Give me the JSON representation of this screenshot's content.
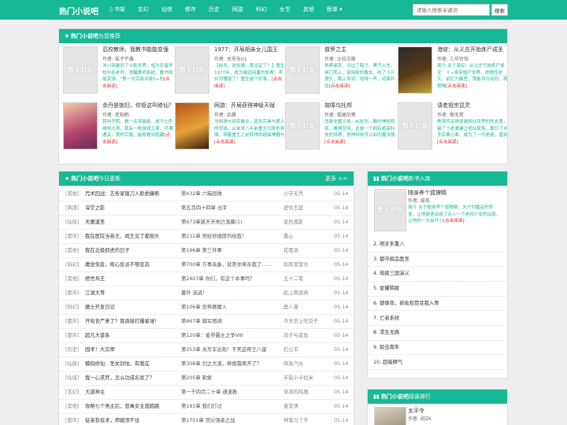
{
  "site": {
    "logo": "热门小说吧"
  },
  "nav": [
    "书架",
    "玄幻",
    "仙侠",
    "都市",
    "历史",
    "网游",
    "科幻",
    "女生",
    "其他",
    "榜单 ▾"
  ],
  "search": {
    "placeholder": "请输入搜索关键词",
    "button": "搜索"
  },
  "recommend": {
    "head_bold": "热门小说吧",
    "head_suffix": "为您推荐",
    "read_label": "[点击阅读]",
    "cover_placeholder": "暂无封面",
    "items": [
      {
        "title": "忍校教师，我教书能能变强",
        "author": "作者: 桔子不酱",
        "desc": "沐川穿越到了火影世界，成为忍者学校中忍老师，觉醒教师系统，教书就能变强。\"第一次完成评级S+的"
      },
      {
        "title": "1977：开局相亲女儿国王",
        "author": "作者: 关市东01",
        "desc": "【前兆，这女婿，我当定了！】重生1977年，成为偏远闭塞的知青！李长河懵逼了！重生是个好事，"
      },
      {
        "title": "普罗之主",
        "author": "作者: 沙拉古斯",
        "desc": "再疼痛苦，冷过了陌子，黑汽火车，够门而入，穿探粉的敬女，吃了十斤馒头，路上惊到，哈呀一声，迎面拦住"
      },
      {
        "title": "港综：从义庄开始炼尸成圣",
        "author": "作者: 三号铃铛",
        "desc": "简介:关于港综：从义庄开始炼尸成圣：十+身穿僵尸世界，得悟性逆天。前忆为藤恶，饿能目行动功。观棺精"
      },
      {
        "title": "余丹是媳妇，你管这叫修仙？",
        "author": "作者: 老柏鹤",
        "desc": "我叫齐熙，是一名穿越者，成为七色雄狗大师，我有一枚游戏玉简，可通通关，我的宗服，能够看到隐藏"
      },
      {
        "title": "网游：开局获得神级天赋",
        "author": "作者: 余晨",
        "desc": "当网游与现实融合，遗到完弟与爱人的背叛，从末世八年前重生归来的吴璨，带着重生之前获得的超级神器与"
      },
      {
        "title": "故障乌托邦",
        "author": "作者: 狐尾的笔",
        "desc": "改装全属义体，AI友划，脑内神经网络，赛博空间，这是一个拥有超高科技的世界，各种科技可以如同魔法般"
      },
      {
        "title": "请老祖宗显灵",
        "author": "作者: 傲无常",
        "desc": "携带转运珠穿越修仙世界的陈玄景，骗了个老婆建立修仙家族，繁衍了许多后裔小辈，成为了一代老祖，直到"
      }
    ]
  },
  "updates": {
    "head_bold": "热门小说吧",
    "head_suffix": "今日更新",
    "more": "更多 >>",
    "rows": [
      {
        "cat": "[其他]",
        "title": "咒术回战：五条家锻刀人斯绝藤断",
        "chap": "第432章 六箱宿傩",
        "author": "小学无凭",
        "date": "05-14"
      },
      {
        "cat": "[网游]",
        "title": "深空之影",
        "chap": "第五百四十四章 出手",
        "author": "虚伪王庭",
        "date": "05-14"
      },
      {
        "cat": "[仙侠]",
        "title": "天魔道圣",
        "chap": "第673章骇天天地已落幕(1)",
        "author": "蓝色孤影",
        "date": "05-14"
      },
      {
        "cat": "[都市]",
        "title": "我在医院当卷王，阎王见了都摇头",
        "chap": "第231章 地狱修缮度的给敌！",
        "author": "桑心",
        "date": "05-14"
      },
      {
        "cat": "[其他]",
        "title": "我在北极抓虎的日子",
        "chap": "第196章 第三件事",
        "author": "花雨溶",
        "date": "05-14"
      },
      {
        "cat": "[科幻]",
        "title": "庸觉免疫，担心反派不够变态",
        "chap": "第700章 万事具备，就差你来杀我了……",
        "author": "陷阵营营长",
        "date": "05-14"
      },
      {
        "cat": "[其他]",
        "title": "绝世兵王",
        "chap": "第2407章 你们，有这个本事吗？",
        "author": "五十二笔",
        "date": "05-14"
      },
      {
        "cat": "[都市]",
        "title": "江湖大哥",
        "chap": "番外 逃逃！",
        "author": "航上南逃燕",
        "date": "05-14"
      },
      {
        "cat": "[科幻]",
        "title": "魔士开发日记",
        "chap": "第106章 恐怖赛魔人",
        "author": "鹿人曼",
        "date": "05-14"
      },
      {
        "cat": "[都市]",
        "title": "开局丧尸来了？我直接打爆星球！",
        "chap": "第467章 棘军困调",
        "author": "今天早上吃饺子",
        "date": "05-14"
      },
      {
        "cat": "[都市]",
        "title": "超凡大谱系",
        "chap": "第120章：星界霸主之争VIII",
        "author": "鸽子与咸鱼",
        "date": "05-14"
      },
      {
        "cat": "[历史]",
        "title": "国术！大宗师",
        "chap": "第353章 关东军出现！于死这帮王八蛋",
        "author": "石山羊",
        "date": "05-14"
      },
      {
        "cat": "[仙侠]",
        "title": "模拟修仙：圣女别怕，有我在",
        "chap": "第308章 剑之大道，柳傲霜离开了？",
        "author": "降族汽水",
        "date": "05-14"
      },
      {
        "cat": "[仙侠]",
        "title": "我一心求死，怎么功成名就了？",
        "chap": "第205章 勒索",
        "author": "天裂小卡拉米",
        "date": "05-14"
      },
      {
        "cat": "[玄幻]",
        "title": "大道神主",
        "chap": "第一千四百二十章 通道教",
        "author": "來滞的鸠凰",
        "date": "05-14"
      },
      {
        "cat": "[其他]",
        "title": "攻略七个男主后，悲毒女主想跑路",
        "chap": "第191章 我们打过",
        "author": "香宜清",
        "date": "05-14"
      },
      {
        "cat": "[都市]",
        "title": "徒弟有技术，师娘顶不住",
        "chap": "第1701章 顶尖强者之战",
        "author": "神笔马丁手",
        "date": "05-14"
      }
    ]
  },
  "newbooks": {
    "head_bold": "热门小说吧",
    "head_suffix": "新书入库",
    "featured": {
      "title": "随身养个狐狸精",
      "author": "作者: 废剪",
      "desc": "简介:关于随身养个狐狸精：天才剑魔品的转变，让他被逐出成了名人一个老祠少女的出现，让他的一次会开小"
    },
    "items": [
      "2. 明末朱重八",
      "3. 都市极品医圣",
      "4. 萌娘三国演义",
      "5. 星耀韩娱",
      "6. 替嫁夜，疯批权臣变我入骨",
      "7. 亡者系统",
      "8. 求生无路",
      "9. 狼击南朱",
      "10. 超级精气"
    ]
  },
  "ranking": {
    "head_bold": "热门小说吧",
    "head_suffix": "阅读排行",
    "first": {
      "title": "太平令",
      "author": "作者: 阎ZK"
    }
  }
}
